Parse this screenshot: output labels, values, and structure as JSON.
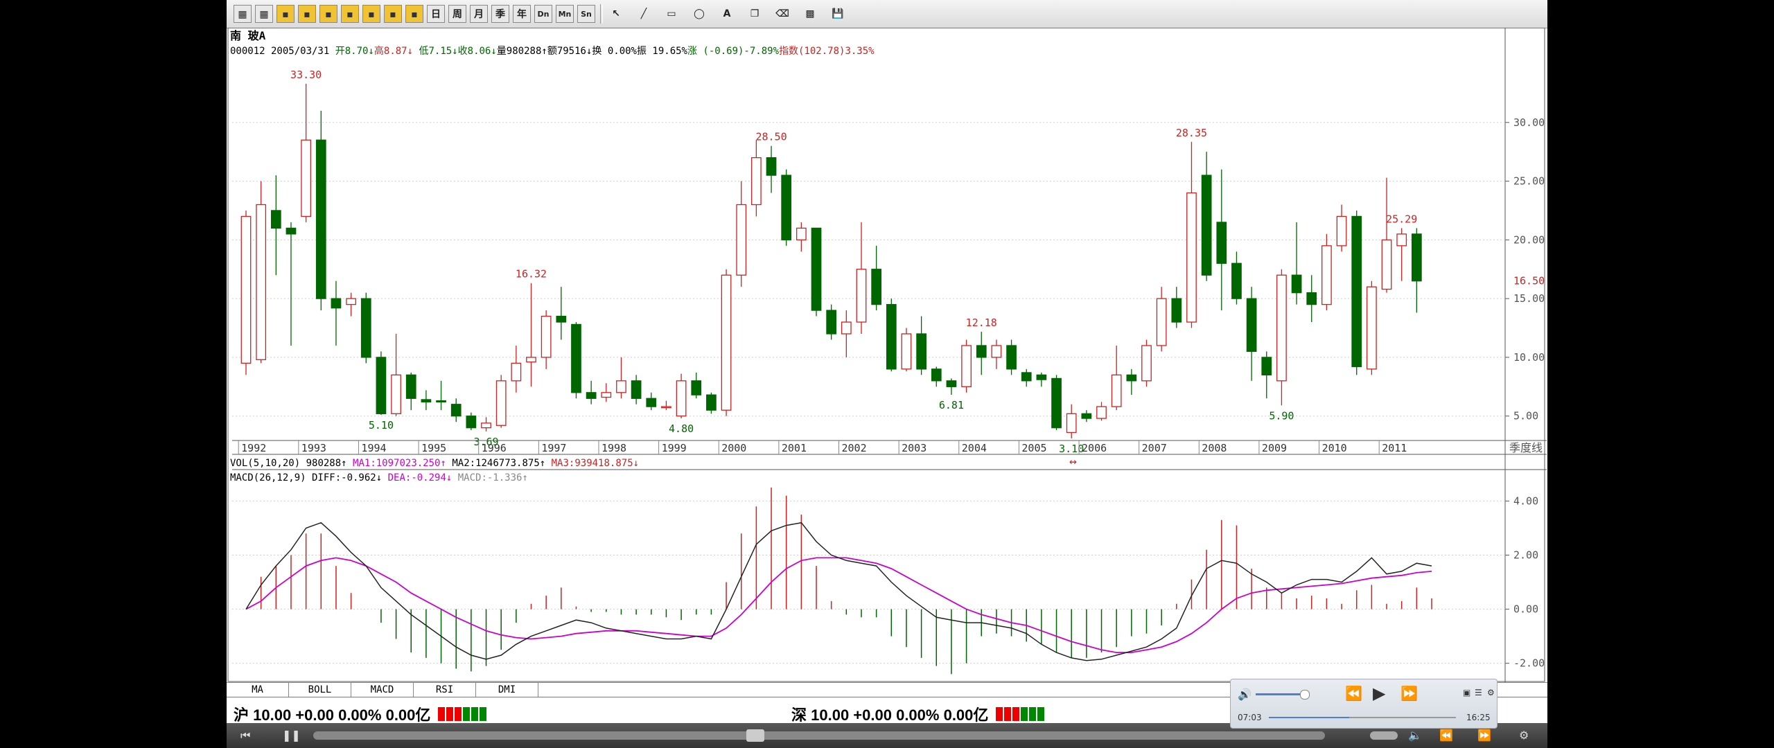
{
  "stock": {
    "name": "南  玻A",
    "code": "000012",
    "date": "2005/03/31",
    "open_label": "开",
    "open": "8.70",
    "high_label": "高",
    "high": "8.87",
    "low_label": "低",
    "low": "7.15",
    "close_label": "收",
    "close": "8.06",
    "vol_label": "量",
    "volume": "980288",
    "amt_label": "额",
    "amount": "79516",
    "turn_label": "换",
    "turnover": "0.00%",
    "amp_label": "振",
    "amplitude": "19.65%",
    "chg_label": "涨",
    "change": "(-0.69)-7.89%",
    "index_label": "指数",
    "index": "(102.78)3.35%"
  },
  "colors": {
    "up": "#cc2222",
    "down": "#006600",
    "ma1": "#cc00cc",
    "grid": "#cfcfcf"
  },
  "toolbar": {
    "buttons": [
      "日",
      "周",
      "月",
      "季",
      "年",
      "Dn",
      "Mn",
      "Sn"
    ],
    "icons": [
      "line-chart-icon",
      "bar-chart-icon",
      "period-1-icon",
      "period-5-icon",
      "period-15-icon",
      "period-30-icon",
      "period-60-icon",
      "period-day-icon",
      "period-week-icon",
      "cursor-icon",
      "draw-line-icon",
      "rect-icon",
      "ellipse-icon",
      "text-icon",
      "copy-icon",
      "erase-icon",
      "palette-icon",
      "save-icon"
    ]
  },
  "period_label": "季度线",
  "vol_panel": {
    "label": "VOL(5,10,20)",
    "value": "980288",
    "ma1": "MA1:1097023.250",
    "ma2": "MA2:1246773.875",
    "ma3": "MA3:939418.875"
  },
  "macd_panel": {
    "label": "MACD(26,12,9)",
    "diff": "DIFF:-0.962",
    "dea": "DEA:-0.294",
    "macd": "MACD:-1.336"
  },
  "tabs": [
    "MA",
    "BOLL",
    "MACD",
    "RSI",
    "DMI"
  ],
  "index_sh": {
    "name": "沪",
    "text": "10.00 +0.00 0.00% 0.00亿"
  },
  "index_sz": {
    "name": "深",
    "text": "10.00 +0.00 0.00% 0.00亿"
  },
  "player": {
    "elapsed": "07:03",
    "total": "16:25"
  },
  "chart_data": [
    {
      "type": "candlestick",
      "years": [
        "1992",
        "1993",
        "1994",
        "1995",
        "1996",
        "1997",
        "1998",
        "1999",
        "2000",
        "2001",
        "2002",
        "2003",
        "2004",
        "2005",
        "2006",
        "2007",
        "2008",
        "2009",
        "2010",
        "2011"
      ],
      "y_ticks": [
        "30.00",
        "25.00",
        "20.00",
        "15.00",
        "10.00",
        "5.00"
      ],
      "ylim": [
        2.8,
        35
      ],
      "current_price_label": "16.50",
      "annotations": [
        {
          "text": "33.30",
          "index": 4
        },
        {
          "text": "5.10",
          "index": 9
        },
        {
          "text": "3.69",
          "index": 16
        },
        {
          "text": "16.32",
          "index": 19
        },
        {
          "text": "4.80",
          "index": 29
        },
        {
          "text": "28.50",
          "index": 35
        },
        {
          "text": "6.81",
          "index": 47
        },
        {
          "text": "12.18",
          "index": 49
        },
        {
          "text": "3.10",
          "index": 55
        },
        {
          "text": "28.35",
          "index": 63
        },
        {
          "text": "5.90",
          "index": 69
        },
        {
          "text": "25.29",
          "index": 77
        }
      ],
      "candles": [
        [
          9.5,
          22.0,
          8.5,
          22.5
        ],
        [
          9.8,
          23.0,
          9.5,
          25.0
        ],
        [
          22.5,
          21.0,
          17.0,
          25.5
        ],
        [
          21.0,
          20.5,
          11.0,
          21.5
        ],
        [
          22.0,
          28.5,
          21.5,
          33.3
        ],
        [
          28.5,
          15.0,
          14.0,
          31.0
        ],
        [
          15.0,
          14.2,
          11.0,
          16.5
        ],
        [
          14.5,
          15.0,
          13.5,
          15.5
        ],
        [
          15.0,
          10.0,
          9.5,
          15.5
        ],
        [
          10.0,
          5.2,
          5.1,
          10.5
        ],
        [
          5.2,
          8.5,
          5.0,
          12.0
        ],
        [
          8.5,
          6.5,
          5.5,
          8.7
        ],
        [
          6.4,
          6.2,
          5.5,
          7.2
        ],
        [
          6.3,
          6.2,
          5.5,
          8.0
        ],
        [
          6.0,
          5.0,
          4.5,
          6.5
        ],
        [
          5.0,
          4.0,
          3.8,
          5.3
        ],
        [
          4.0,
          4.4,
          3.69,
          4.9
        ],
        [
          4.2,
          8.0,
          4.0,
          8.5
        ],
        [
          8.0,
          9.5,
          7.0,
          11.0
        ],
        [
          9.6,
          10.0,
          7.5,
          16.32
        ],
        [
          10.0,
          13.5,
          9.0,
          14.0
        ],
        [
          13.5,
          13.0,
          11.5,
          16.0
        ],
        [
          12.8,
          7.0,
          6.5,
          13.0
        ],
        [
          7.0,
          6.5,
          6.0,
          8.0
        ],
        [
          6.6,
          7.0,
          6.2,
          7.8
        ],
        [
          7.0,
          8.0,
          6.5,
          10.0
        ],
        [
          8.0,
          6.5,
          6.0,
          8.5
        ],
        [
          6.5,
          5.8,
          5.5,
          7.0
        ],
        [
          5.8,
          5.8,
          5.5,
          6.3
        ],
        [
          5.0,
          8.0,
          4.8,
          8.6
        ],
        [
          8.0,
          6.8,
          6.5,
          8.7
        ],
        [
          6.8,
          5.5,
          5.2,
          7.0
        ],
        [
          5.5,
          17.0,
          5.0,
          17.5
        ],
        [
          17.0,
          23.0,
          16.0,
          25.0
        ],
        [
          23.0,
          27.0,
          22.0,
          28.5
        ],
        [
          27.0,
          25.5,
          24.0,
          28.0
        ],
        [
          25.5,
          20.0,
          19.5,
          26.0
        ],
        [
          20.0,
          21.0,
          19.0,
          21.5
        ],
        [
          21.0,
          14.0,
          13.5,
          21.0
        ],
        [
          14.0,
          12.0,
          11.5,
          14.5
        ],
        [
          12.0,
          13.0,
          10.0,
          14.0
        ],
        [
          13.0,
          17.5,
          12.0,
          21.5
        ],
        [
          17.5,
          14.5,
          14.0,
          19.5
        ],
        [
          14.5,
          9.0,
          8.8,
          15.0
        ],
        [
          9.0,
          12.0,
          8.8,
          12.5
        ],
        [
          12.0,
          9.0,
          8.5,
          13.5
        ],
        [
          9.0,
          8.0,
          7.5,
          9.2
        ],
        [
          8.0,
          7.5,
          6.81,
          8.2
        ],
        [
          7.5,
          11.0,
          7.0,
          11.5
        ],
        [
          11.0,
          10.0,
          8.5,
          12.18
        ],
        [
          10.0,
          11.0,
          9.0,
          11.5
        ],
        [
          11.0,
          9.0,
          8.5,
          11.5
        ],
        [
          8.7,
          8.0,
          7.5,
          9.0
        ],
        [
          8.5,
          8.1,
          7.5,
          8.7
        ],
        [
          8.2,
          4.0,
          3.8,
          8.5
        ],
        [
          3.6,
          5.2,
          3.1,
          6.0
        ],
        [
          5.2,
          4.8,
          4.5,
          5.5
        ],
        [
          4.8,
          5.8,
          4.6,
          6.2
        ],
        [
          5.8,
          8.5,
          5.5,
          11.0
        ],
        [
          8.5,
          8.0,
          6.8,
          9.0
        ],
        [
          8.0,
          11.0,
          7.5,
          11.5
        ],
        [
          11.0,
          15.0,
          10.5,
          16.0
        ],
        [
          15.0,
          13.0,
          12.5,
          16.0
        ],
        [
          13.0,
          24.0,
          12.5,
          28.35
        ],
        [
          25.5,
          17.0,
          16.5,
          27.5
        ],
        [
          21.5,
          18.0,
          14.0,
          26.0
        ],
        [
          18.0,
          15.0,
          14.5,
          19.0
        ],
        [
          15.0,
          10.5,
          8.0,
          16.0
        ],
        [
          10.0,
          8.5,
          6.5,
          10.5
        ],
        [
          8.0,
          17.0,
          5.9,
          17.5
        ],
        [
          17.0,
          15.5,
          14.5,
          21.5
        ],
        [
          15.5,
          14.5,
          13.0,
          17.0
        ],
        [
          14.5,
          19.5,
          14.0,
          20.5
        ],
        [
          19.5,
          22.0,
          19.0,
          23.0
        ],
        [
          22.0,
          9.2,
          8.5,
          22.5
        ],
        [
          9.0,
          16.0,
          8.5,
          16.5
        ],
        [
          15.8,
          20.0,
          15.5,
          25.29
        ],
        [
          19.5,
          20.5,
          16.5,
          21.0
        ],
        [
          20.5,
          16.5,
          13.8,
          21.0
        ]
      ]
    },
    {
      "type": "line+bar",
      "name": "MACD",
      "y_ticks": [
        "4.00",
        "2.00",
        "0.00",
        "-2.00"
      ],
      "ylim": [
        -2.7,
        4.6
      ],
      "diff": [
        0,
        0.9,
        1.6,
        2.2,
        3.0,
        3.2,
        2.7,
        2.1,
        1.6,
        0.8,
        0.3,
        -0.2,
        -0.6,
        -1.0,
        -1.4,
        -1.7,
        -1.85,
        -1.7,
        -1.3,
        -1.0,
        -0.8,
        -0.6,
        -0.4,
        -0.5,
        -0.7,
        -0.8,
        -0.9,
        -1.0,
        -1.1,
        -1.1,
        -1.0,
        -1.1,
        0.0,
        1.2,
        2.4,
        2.9,
        3.1,
        3.2,
        2.5,
        2.0,
        1.8,
        1.7,
        1.6,
        1.0,
        0.5,
        0.1,
        -0.3,
        -0.4,
        -0.5,
        -0.5,
        -0.6,
        -0.7,
        -0.9,
        -1.3,
        -1.6,
        -1.8,
        -1.9,
        -1.85,
        -1.7,
        -1.55,
        -1.4,
        -1.1,
        -0.7,
        0.5,
        1.5,
        1.8,
        1.7,
        1.3,
        1.0,
        0.6,
        0.9,
        1.1,
        1.1,
        1.0,
        1.4,
        1.9,
        1.3,
        1.4,
        1.7,
        1.6
      ],
      "dea": [
        0,
        0.3,
        0.8,
        1.2,
        1.6,
        1.8,
        1.9,
        1.8,
        1.6,
        1.3,
        1.0,
        0.6,
        0.3,
        0.0,
        -0.3,
        -0.55,
        -0.8,
        -0.95,
        -1.05,
        -1.1,
        -1.05,
        -1.0,
        -0.9,
        -0.85,
        -0.8,
        -0.8,
        -0.8,
        -0.85,
        -0.9,
        -0.95,
        -1.0,
        -1.0,
        -0.7,
        -0.2,
        0.4,
        1.0,
        1.5,
        1.8,
        1.9,
        1.9,
        1.9,
        1.8,
        1.7,
        1.5,
        1.2,
        0.9,
        0.6,
        0.3,
        0.0,
        -0.2,
        -0.35,
        -0.5,
        -0.6,
        -0.8,
        -1.0,
        -1.2,
        -1.35,
        -1.5,
        -1.6,
        -1.6,
        -1.5,
        -1.4,
        -1.2,
        -0.9,
        -0.5,
        0.0,
        0.4,
        0.6,
        0.7,
        0.75,
        0.8,
        0.85,
        0.9,
        0.95,
        1.05,
        1.15,
        1.2,
        1.25,
        1.35,
        1.4
      ],
      "macd": [
        0,
        1.2,
        1.6,
        2.0,
        2.8,
        2.8,
        1.6,
        0.6,
        0.0,
        -0.5,
        -1.1,
        -1.6,
        -1.8,
        -2.0,
        -2.2,
        -2.3,
        -2.1,
        -1.5,
        -0.5,
        0.2,
        0.5,
        0.8,
        0.1,
        -0.1,
        -0.1,
        -0.2,
        -0.2,
        -0.2,
        -0.3,
        -0.4,
        -0.2,
        -0.2,
        1.0,
        2.8,
        3.8,
        4.5,
        4.2,
        3.5,
        1.6,
        0.3,
        -0.2,
        -0.3,
        -0.3,
        -1.0,
        -1.4,
        -1.8,
        -2.1,
        -2.4,
        -2.0,
        -1.0,
        -0.9,
        -1.0,
        -1.2,
        -1.3,
        -1.6,
        -1.8,
        -1.8,
        -1.6,
        -1.4,
        -1.0,
        -0.9,
        -0.6,
        0.2,
        1.1,
        2.2,
        3.3,
        3.1,
        1.5,
        0.8,
        0.6,
        0.4,
        0.5,
        0.4,
        0.2,
        0.7,
        0.9,
        0.2,
        0.3,
        0.8,
        0.4
      ]
    }
  ]
}
